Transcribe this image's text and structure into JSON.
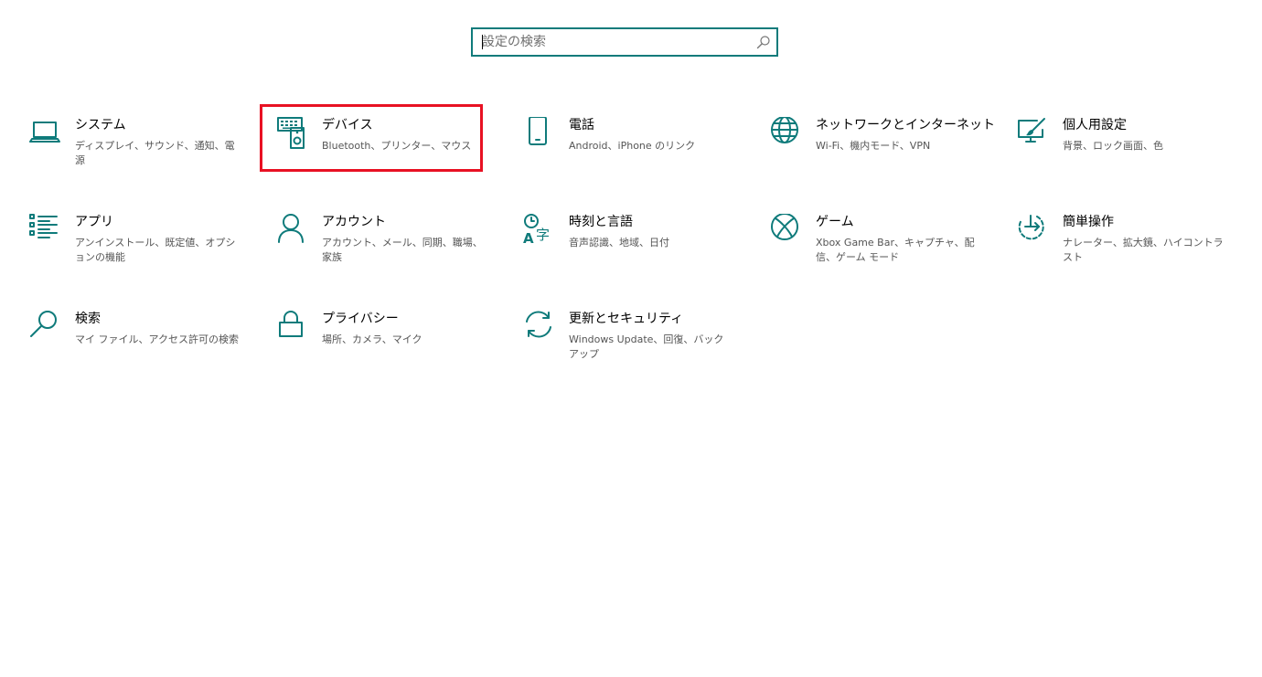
{
  "search": {
    "placeholder": "設定の検索",
    "value": ""
  },
  "accent_color": "#0f7b7b",
  "highlight_color": "#e81123",
  "tiles": [
    {
      "icon": "laptop-icon",
      "title": "システム",
      "desc": "ディスプレイ、サウンド、通知、電源"
    },
    {
      "icon": "devices-icon",
      "title": "デバイス",
      "desc": "Bluetooth、プリンター、マウス"
    },
    {
      "icon": "phone-icon",
      "title": "電話",
      "desc": "Android、iPhone のリンク"
    },
    {
      "icon": "globe-icon",
      "title": "ネットワークとインターネット",
      "desc": "Wi-Fi、機内モード、VPN"
    },
    {
      "icon": "personalization-icon",
      "title": "個人用設定",
      "desc": "背景、ロック画面、色"
    },
    {
      "icon": "apps-list-icon",
      "title": "アプリ",
      "desc": "アンインストール、既定値、オプションの機能"
    },
    {
      "icon": "person-icon",
      "title": "アカウント",
      "desc": "アカウント、メール、同期、職場、家族"
    },
    {
      "icon": "time-language-icon",
      "title": "時刻と言語",
      "desc": "音声認識、地域、日付"
    },
    {
      "icon": "xbox-icon",
      "title": "ゲーム",
      "desc": "Xbox Game Bar、キャプチャ、配信、ゲーム モード"
    },
    {
      "icon": "ease-of-access-icon",
      "title": "簡単操作",
      "desc": "ナレーター、拡大鏡、ハイコントラスト"
    },
    {
      "icon": "search-icon",
      "title": "検索",
      "desc": "マイ ファイル、アクセス許可の検索"
    },
    {
      "icon": "lock-icon",
      "title": "プライバシー",
      "desc": "場所、カメラ、マイク"
    },
    {
      "icon": "sync-icon",
      "title": "更新とセキュリティ",
      "desc": "Windows Update、回復、バックアップ"
    }
  ]
}
